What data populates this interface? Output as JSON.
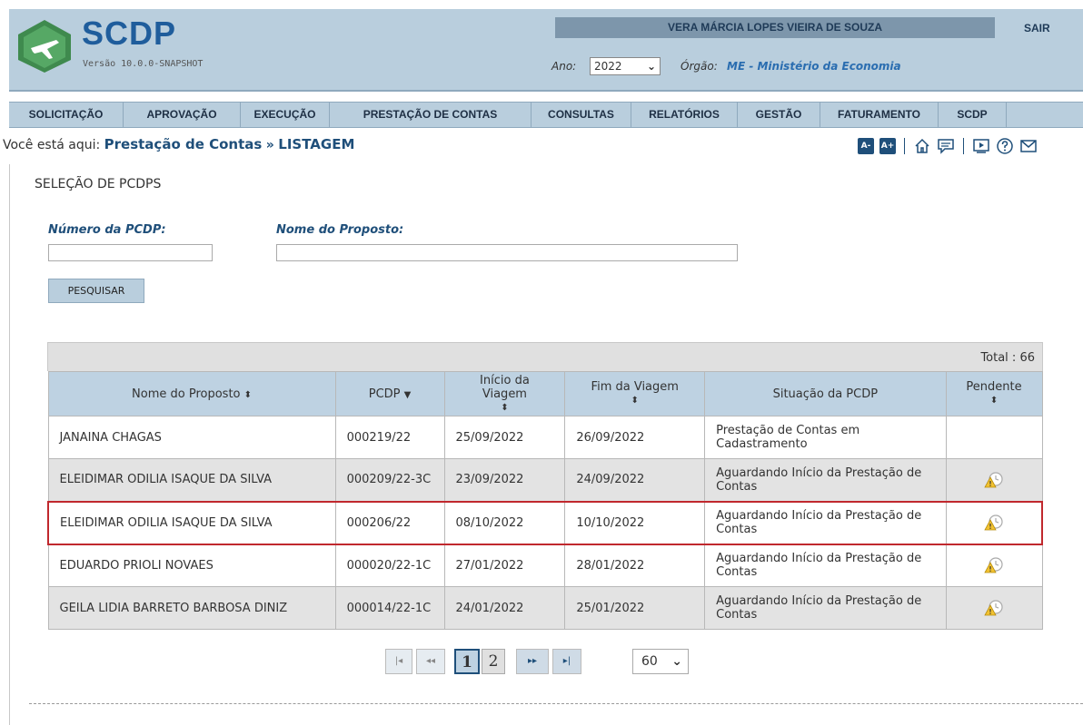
{
  "app": {
    "name": "SCDP",
    "version": "Versão 10.0.0-SNAPSHOT",
    "user": "VERA MÁRCIA LOPES VIEIRA DE SOUZA",
    "logout": "SAIR",
    "ano_label": "Ano:",
    "ano_value": "2022",
    "orgao_label": "Órgão:",
    "orgao_value": "ME - Ministério da Economia"
  },
  "menu": [
    "SOLICITAÇÃO",
    "APROVAÇÃO",
    "EXECUÇÃO",
    "PRESTAÇÃO DE CONTAS",
    "CONSULTAS",
    "RELATÓRIOS",
    "GESTÃO",
    "FATURAMENTO",
    "SCDP"
  ],
  "breadcrumb": {
    "prefix": "Você está aqui:",
    "section": "Prestação de Contas",
    "separator": "»",
    "page": "LISTAGEM"
  },
  "tools": {
    "font_decrease": "A-",
    "font_increase": "A+"
  },
  "search": {
    "title": "SELEÇÃO DE PCDPS",
    "pcdp_label": "Número da PCDP:",
    "pcdp_value": "",
    "nome_label": "Nome do Proposto:",
    "nome_value": "",
    "button": "PESQUISAR"
  },
  "table": {
    "total": "Total : 66",
    "headers": {
      "nome": "Nome do Proposto",
      "pcdp": "PCDP",
      "inicio": "Início da Viagem",
      "fim": "Fim da Viagem",
      "situacao": "Situação da PCDP",
      "pendente": "Pendente"
    },
    "rows": [
      {
        "nome": "JANAINA CHAGAS",
        "pcdp": "000219/22",
        "inicio": "25/09/2022",
        "fim": "26/09/2022",
        "situacao": "Prestação de Contas em Cadastramento",
        "pendente": false
      },
      {
        "nome": "ELEIDIMAR ODILIA ISAQUE DA SILVA",
        "pcdp": "000209/22-3C",
        "inicio": "23/09/2022",
        "fim": "24/09/2022",
        "situacao": "Aguardando Início da Prestação de Contas",
        "pendente": true
      },
      {
        "nome": "ELEIDIMAR ODILIA ISAQUE DA SILVA",
        "pcdp": "000206/22",
        "inicio": "08/10/2022",
        "fim": "10/10/2022",
        "situacao": "Aguardando Início da Prestação de Contas",
        "pendente": true
      },
      {
        "nome": "EDUARDO PRIOLI NOVAES",
        "pcdp": "000020/22-1C",
        "inicio": "27/01/2022",
        "fim": "28/01/2022",
        "situacao": "Aguardando Início da Prestação de Contas",
        "pendente": true
      },
      {
        "nome": "GEILA LIDIA BARRETO BARBOSA DINIZ",
        "pcdp": "000014/22-1C",
        "inicio": "24/01/2022",
        "fim": "25/01/2022",
        "situacao": "Aguardando Início da Prestação de Contas",
        "pendente": true
      }
    ],
    "selected_row": 2
  },
  "pager": {
    "first": "|◂",
    "prev": "◂◂",
    "pages": [
      "1",
      "2"
    ],
    "current": "1",
    "next": "▸▸",
    "last": "▸|",
    "per_page": "60"
  },
  "colors": {
    "header_bg": "#b9cedd",
    "accent": "#1f4f7a",
    "highlight_border": "#c0282d"
  }
}
